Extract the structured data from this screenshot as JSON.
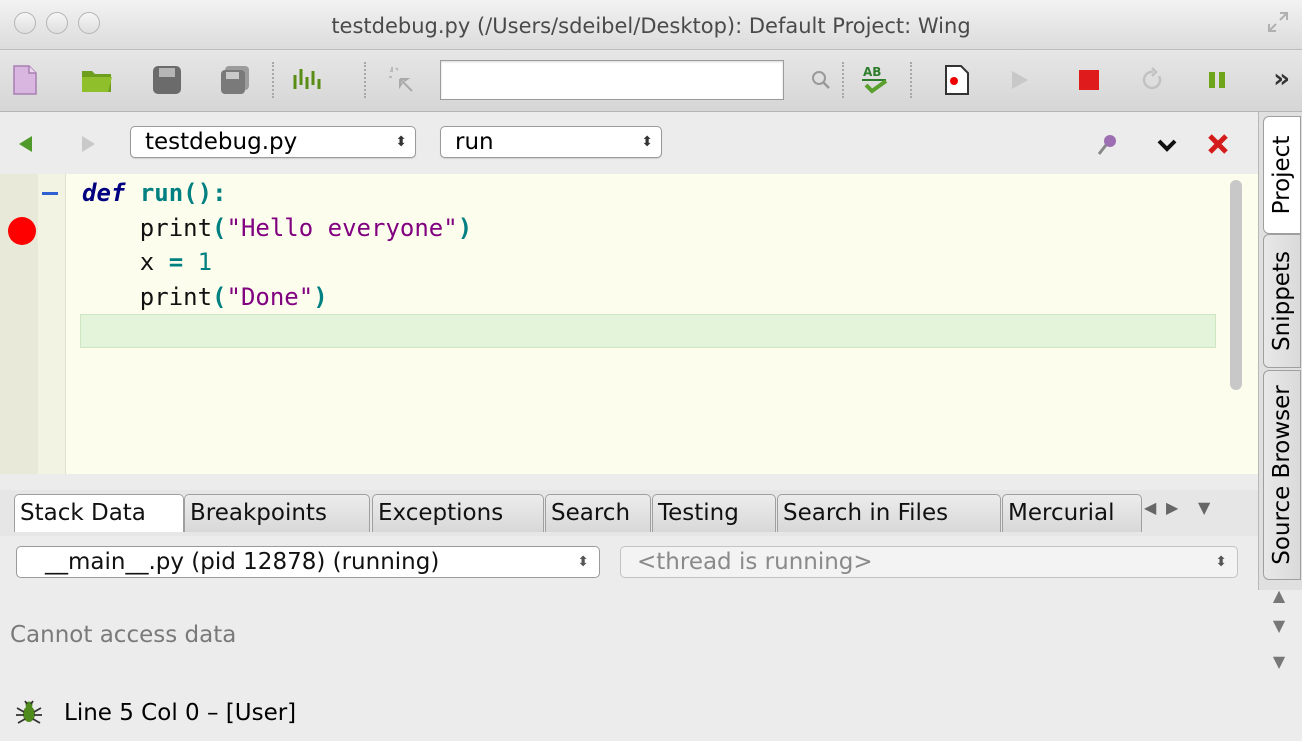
{
  "window": {
    "title": "testdebug.py (/Users/sdeibel/Desktop): Default Project: Wing"
  },
  "toolbar": {
    "search_value": "",
    "more": "»"
  },
  "editor_header": {
    "file_combo": "testdebug.py",
    "scope_combo": "run"
  },
  "editor": {
    "lines": [
      {
        "indent": "",
        "tokens": [
          {
            "t": "def",
            "c": "kw"
          },
          {
            "t": " ",
            "c": ""
          },
          {
            "t": "run",
            "c": "fn"
          },
          {
            "t": "():",
            "c": "fn"
          }
        ]
      },
      {
        "indent": "    ",
        "tokens": [
          {
            "t": "print",
            "c": ""
          },
          {
            "t": "(",
            "c": "fn"
          },
          {
            "t": "\"Hello everyone\"",
            "c": "str"
          },
          {
            "t": ")",
            "c": "fn"
          }
        ]
      },
      {
        "indent": "    ",
        "tokens": [
          {
            "t": "x",
            "c": ""
          },
          {
            "t": " = ",
            "c": "fn"
          },
          {
            "t": "1",
            "c": "num"
          }
        ]
      },
      {
        "indent": "    ",
        "tokens": [
          {
            "t": "print",
            "c": ""
          },
          {
            "t": "(",
            "c": "fn"
          },
          {
            "t": "\"Done\"",
            "c": "str"
          },
          {
            "t": ")",
            "c": "fn"
          }
        ]
      }
    ]
  },
  "side_tabs": [
    "Project",
    "Snippets",
    "Source Browser"
  ],
  "tools": {
    "tabs": [
      "Stack Data",
      "Breakpoints",
      "Exceptions",
      "Search",
      "Testing",
      "Search in Files",
      "Mercurial"
    ],
    "active_tab": "Stack Data",
    "process_combo": "__main__.py (pid 12878) (running)",
    "thread_combo": "<thread is running>",
    "message": "Cannot access data"
  },
  "status": {
    "text": "Line 5 Col 0 – [User]"
  },
  "colors": {
    "breakpoint": "#ff0000",
    "keyword": "#000080",
    "string": "#800080",
    "current_line": "#e3f4da",
    "editor_bg": "#fdfdee"
  }
}
